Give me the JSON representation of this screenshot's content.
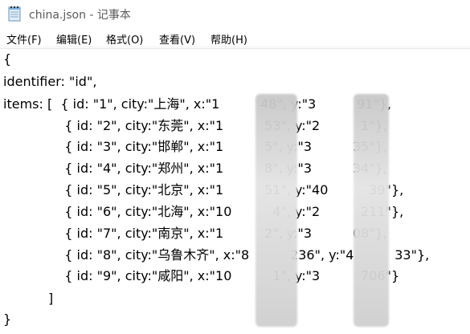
{
  "window": {
    "title": "china.json - 记事本"
  },
  "menu": {
    "items": [
      "文件(F)",
      "编辑(E)",
      "格式(O)",
      "查看(V)",
      "帮助(H)"
    ]
  },
  "document": {
    "lines": [
      "{",
      "identifier: \"id\",",
      "items: [  { id: \"1\", city:\"上海\", x:\"1          48\", y:\"3          91\"},",
      "               { id: \"2\", city:\"东莞\", x:\"1          53\", y:\"2          1\"},",
      "               { id: \"3\", city:\"邯郸\", x:\"1          5\", y:\"3          35\"},",
      "               { id: \"4\", city:\"郑州\", x:\"1          8\", y:\"3          34\"},",
      "               { id: \"5\", city:\"北京\", x:\"1          51\", y:\"40          39\"},",
      "               { id: \"6\", city:\"北海\", x:\"10          4\", y:\"2          211\"},",
      "               { id: \"7\", city:\"南京\", x:\"1          2\", y:\"3          08\"},",
      "               { id: \"8\", city:\"乌鲁木齐\", x:\"8          236\", y:\"4          33\"},",
      "               { id: \"9\", city:\"咸阳\", x:\"10          1\", y:\"3          706\"}",
      "           ]",
      "}"
    ]
  },
  "icons": {
    "app": "notepad-icon"
  }
}
